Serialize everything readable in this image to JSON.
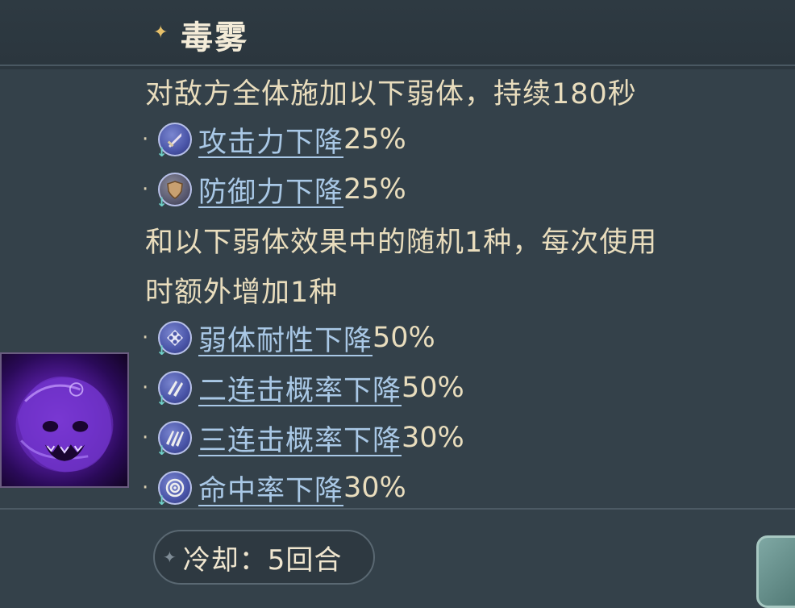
{
  "skill": {
    "name": "毒雾",
    "description_line1": "对敌方全体施加以下弱体，持续180秒",
    "description_line2": "和以下弱体效果中的随机1种，每次使用",
    "description_line3": "时额外增加1种"
  },
  "fixed_debuffs": [
    {
      "icon": "sword-down-icon",
      "name": "攻击力下降",
      "value": "25%"
    },
    {
      "icon": "shield-down-icon",
      "name": "防御力下降",
      "value": "25%"
    }
  ],
  "random_debuffs": [
    {
      "icon": "debuff-resist-down-icon",
      "name": "弱体耐性下降",
      "value": "50%"
    },
    {
      "icon": "double-strike-down-icon",
      "name": "二连击概率下降",
      "value": "50%"
    },
    {
      "icon": "triple-strike-down-icon",
      "name": "三连击概率下降",
      "value": "30%"
    },
    {
      "icon": "accuracy-down-icon",
      "name": "命中率下降",
      "value": "30%"
    }
  ],
  "bullet": "·",
  "cooldown": {
    "label": "冷却：5回合"
  },
  "colors": {
    "link": "#a9c8e6",
    "text": "#e9ddbd",
    "background": "#34414a",
    "icon": "#4a55a8"
  }
}
